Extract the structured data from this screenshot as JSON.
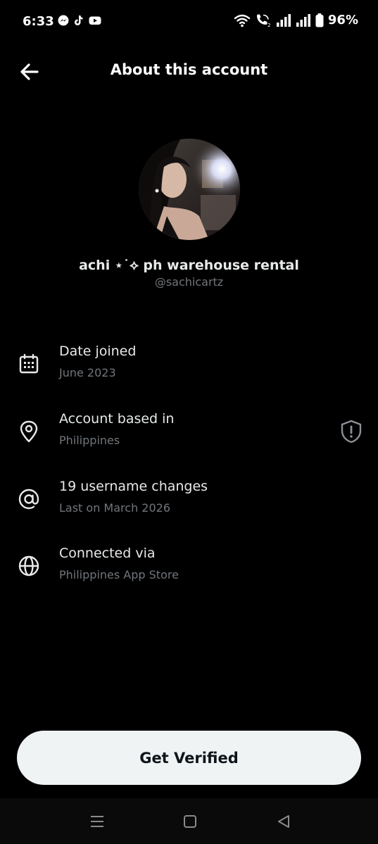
{
  "status_bar": {
    "time": "6:33",
    "battery": "96%"
  },
  "header": {
    "title": "About this account"
  },
  "profile": {
    "display_name": "achi ⋆˙⟡ ph warehouse rental",
    "handle": "@sachicartz"
  },
  "info": [
    {
      "icon": "calendar-icon",
      "title": "Date joined",
      "subtitle": "June 2023"
    },
    {
      "icon": "location-pin-icon",
      "title": "Account based in",
      "subtitle": "Philippines"
    },
    {
      "icon": "at-sign-icon",
      "title": "19 username changes",
      "subtitle": "Last on March 2026"
    },
    {
      "icon": "globe-icon",
      "title": "Connected via",
      "subtitle": "Philippines App Store"
    }
  ],
  "verify_button": {
    "label": "Get Verified"
  },
  "colors": {
    "background": "#000000",
    "primary_text": "#e7e9ea",
    "secondary_text": "#71767b",
    "button_bg": "#eff3f4",
    "button_text": "#0f1419"
  }
}
